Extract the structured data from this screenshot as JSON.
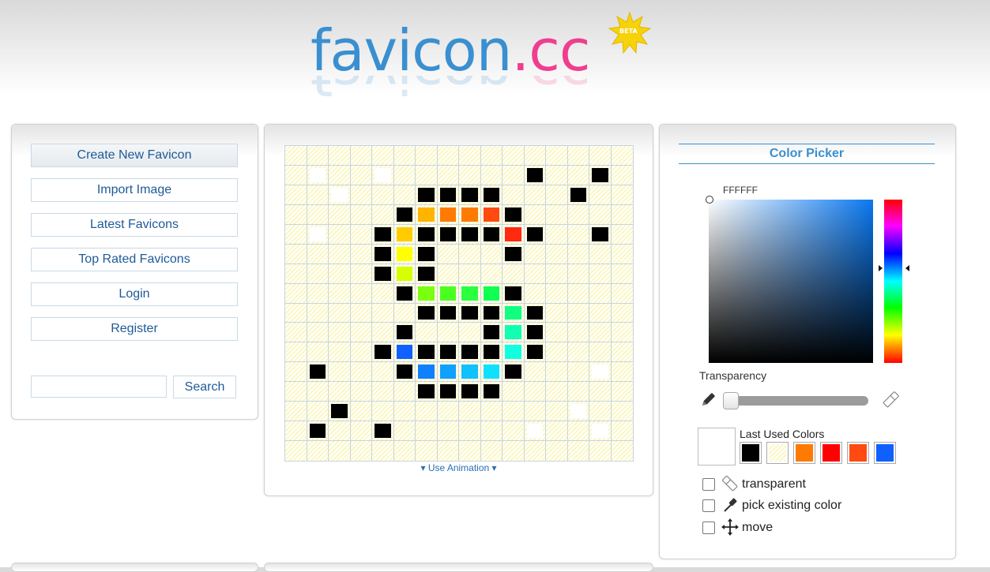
{
  "logo": {
    "main": "favicon",
    "dot": ".",
    "tld": "cc",
    "badge": "BETA"
  },
  "nav": {
    "items": [
      {
        "label": "Create New Favicon"
      },
      {
        "label": "Import Image"
      },
      {
        "label": "Latest Favicons"
      },
      {
        "label": "Top Rated Favicons"
      },
      {
        "label": "Login"
      },
      {
        "label": "Register"
      }
    ],
    "search": {
      "value": "",
      "placeholder": "",
      "button": "Search"
    }
  },
  "editor": {
    "grid_size": 16,
    "animation_link": "Use Animation",
    "pixels": [
      [
        ".",
        ".",
        ".",
        ".",
        ".",
        ".",
        ".",
        ".",
        ".",
        ".",
        ".",
        ".",
        ".",
        ".",
        ".",
        "."
      ],
      [
        ".",
        "W",
        ".",
        ".",
        "W",
        ".",
        ".",
        ".",
        ".",
        ".",
        ".",
        "K",
        ".",
        ".",
        "K",
        "."
      ],
      [
        ".",
        ".",
        "W",
        ".",
        ".",
        ".",
        "K",
        "K",
        "K",
        "K",
        ".",
        ".",
        ".",
        "K",
        ".",
        "."
      ],
      [
        ".",
        ".",
        ".",
        ".",
        ".",
        "K",
        "#ffb400",
        "#ff7a00",
        "#ff7a00",
        "#ff4a10",
        "K",
        ".",
        ".",
        ".",
        ".",
        "."
      ],
      [
        ".",
        "W",
        ".",
        ".",
        "K",
        "#ffcc00",
        "K",
        "K",
        "K",
        "K",
        "#ff2a10",
        "K",
        ".",
        ".",
        "K",
        "."
      ],
      [
        ".",
        ".",
        ".",
        ".",
        "K",
        "#ffff00",
        "K",
        ".",
        ".",
        ".",
        "K",
        ".",
        ".",
        ".",
        ".",
        "."
      ],
      [
        ".",
        ".",
        ".",
        ".",
        "K",
        "#d6ff00",
        "K",
        ".",
        ".",
        ".",
        ".",
        ".",
        ".",
        ".",
        ".",
        "."
      ],
      [
        ".",
        ".",
        ".",
        ".",
        ".",
        "K",
        "#7aff10",
        "#4aff20",
        "#2aff40",
        "#10ff50",
        "K",
        ".",
        ".",
        ".",
        ".",
        "."
      ],
      [
        ".",
        ".",
        ".",
        ".",
        ".",
        ".",
        "K",
        "K",
        "K",
        "K",
        "#10ff80",
        "K",
        ".",
        ".",
        ".",
        "."
      ],
      [
        ".",
        ".",
        ".",
        ".",
        ".",
        "K",
        ".",
        ".",
        ".",
        "K",
        "#10ffb0",
        "K",
        ".",
        ".",
        ".",
        "."
      ],
      [
        ".",
        ".",
        ".",
        ".",
        "K",
        "#1060ff",
        "K",
        "K",
        "K",
        "K",
        "#10ffe0",
        "K",
        ".",
        ".",
        ".",
        "."
      ],
      [
        ".",
        "K",
        ".",
        ".",
        ".",
        "K",
        "#1080ff",
        "#10a0ff",
        "#10c0ff",
        "#10e0ff",
        "K",
        ".",
        ".",
        ".",
        "W",
        "."
      ],
      [
        ".",
        ".",
        ".",
        ".",
        ".",
        ".",
        "K",
        "K",
        "K",
        "K",
        ".",
        ".",
        ".",
        ".",
        ".",
        "."
      ],
      [
        ".",
        ".",
        "K",
        ".",
        ".",
        ".",
        ".",
        ".",
        ".",
        ".",
        ".",
        ".",
        ".",
        "W",
        ".",
        "."
      ],
      [
        ".",
        "K",
        ".",
        ".",
        "K",
        ".",
        ".",
        ".",
        ".",
        ".",
        ".",
        "W",
        ".",
        ".",
        "W",
        "."
      ],
      [
        ".",
        ".",
        ".",
        ".",
        ".",
        ".",
        ".",
        ".",
        ".",
        ".",
        ".",
        ".",
        ".",
        ".",
        ".",
        "."
      ]
    ]
  },
  "color_picker": {
    "title": "Color Picker",
    "hex": "FFFFFF",
    "transparency_label": "Transparency",
    "transparency_value": 0,
    "last_used_label": "Last Used Colors",
    "current_color": "#ffffff",
    "last_used": [
      "#000000",
      "transparent",
      "#ff7a00",
      "#ff0000",
      "#ff4a10",
      "#1060ff"
    ],
    "options": [
      {
        "label": "transparent",
        "icon": "eraser-icon",
        "checked": false
      },
      {
        "label": "pick existing color",
        "icon": "eyedropper-icon",
        "checked": false
      },
      {
        "label": "move",
        "icon": "move-icon",
        "checked": false
      }
    ]
  },
  "colors": {
    "accent": "#3a8fd0",
    "brand_pink": "#ef3e8f",
    "link": "#1f5a96"
  }
}
